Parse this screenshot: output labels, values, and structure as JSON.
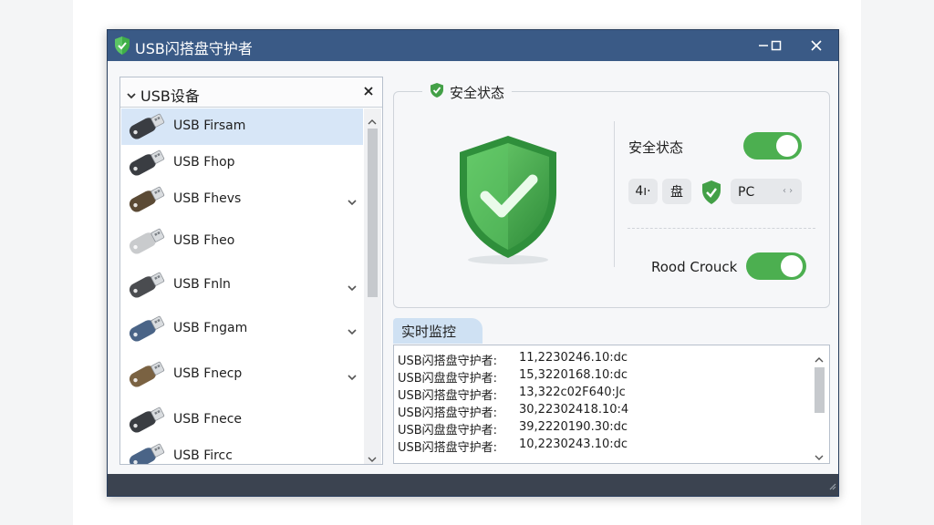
{
  "window": {
    "title": "USB闪搭盘守护者",
    "controls": [
      "minimize",
      "maximize",
      "close"
    ],
    "accent": "#3a5a86"
  },
  "left_panel": {
    "header": "USB设备",
    "devices": [
      {
        "label": "USB Firsam",
        "color": "#3a3d42",
        "selected": true
      },
      {
        "label": "USB Fhop",
        "color": "#3a3d42",
        "expandable": false
      },
      {
        "label": "USB Fhevs",
        "color": "#5b4a35",
        "expandable": true
      },
      {
        "label": "USB Fheo",
        "color": "#c9cbcd",
        "expandable": false
      },
      {
        "label": "USB Fnln",
        "color": "#4a4c50",
        "expandable": true
      },
      {
        "label": "USB Fngam",
        "color": "#4a6487",
        "expandable": true
      },
      {
        "label": "USB Fnecp",
        "color": "#7a6242",
        "expandable": true
      },
      {
        "label": "USB Fnece",
        "color": "#3a3d42",
        "expandable": false
      },
      {
        "label": "USB Fircc",
        "color": "#4a6487",
        "expandable": false
      }
    ]
  },
  "security": {
    "legend": "安全状态",
    "toggle1_label": "安全状态",
    "toggle1_on": true,
    "btn1": "4ı·",
    "btn2": "盘",
    "pc_label": "PC",
    "pc_arrows": "‹ ›",
    "toggle2_label": "Rood Crouck",
    "toggle2_on": true,
    "colors": {
      "ok": "#4caf50",
      "shield": "#43a047"
    }
  },
  "monitor": {
    "tab": "实时监控",
    "logs": [
      {
        "src": "USB闪搭盘守护者:",
        "val": "11,2230246.10:dc"
      },
      {
        "src": "USB闪盘盘守护者:",
        "val": "15,3220168.10:dc"
      },
      {
        "src": "USB闪搭盘守护者:",
        "val": "13,322c02F640:Jc"
      },
      {
        "src": "USB闪搭盘守护者:",
        "val": "30,22302418.10:4"
      },
      {
        "src": "USB闪盘盘守护者:",
        "val": "39,2220190.30:dc"
      },
      {
        "src": "USB闪搭盘守护者:",
        "val": "10,2230243.10:dc"
      }
    ]
  }
}
